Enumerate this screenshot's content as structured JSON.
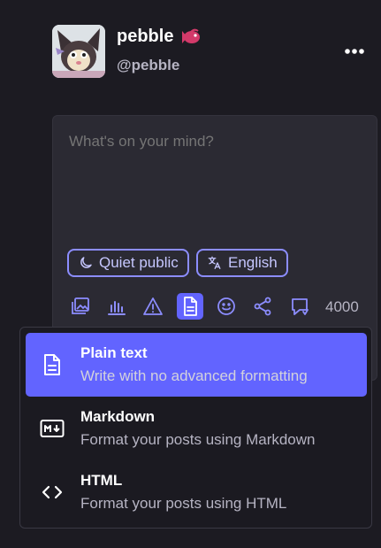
{
  "profile": {
    "display_name": "pebble",
    "handle": "@pebble",
    "avatar_icon": "avatar-image",
    "badge_icon": "fish-emoji-icon"
  },
  "composer": {
    "placeholder": "What's on your mind?",
    "visibility_label": "Quiet public",
    "language_label": "English",
    "char_count": "4000",
    "accent_color": "#6264ff",
    "toolbar_icons": [
      "media-icon",
      "poll-icon",
      "warning-icon",
      "format-icon",
      "emoji-icon",
      "share-icon",
      "reply-icon"
    ]
  },
  "format_menu": {
    "selected": "Plain text",
    "items": [
      {
        "title": "Plain text",
        "description": "Write with no advanced formatting",
        "icon": "document-icon"
      },
      {
        "title": "Markdown",
        "description": "Format your posts using Markdown",
        "icon": "markdown-icon"
      },
      {
        "title": "HTML",
        "description": "Format your posts using HTML",
        "icon": "code-icon"
      }
    ]
  }
}
